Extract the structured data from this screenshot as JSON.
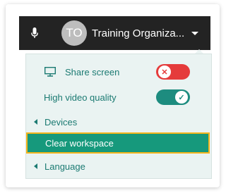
{
  "topbar": {
    "avatar_initials": "TO",
    "org_name": "Training Organiza...",
    "icons": {
      "microphone": "microphone-icon",
      "caret": "caret-down-icon"
    },
    "colors": {
      "background": "#232323",
      "avatar": "#bdbdbd"
    }
  },
  "menu": {
    "share_screen": {
      "label": "Share screen",
      "icon": "monitor-icon",
      "toggle_state": "off",
      "toggle_color": "#e53b3b"
    },
    "high_video_quality": {
      "label": "High video quality",
      "toggle_state": "on",
      "toggle_color": "#1d8c7f"
    },
    "devices": {
      "label": "Devices",
      "icon": "submenu-left-icon"
    },
    "clear_workspace": {
      "label": "Clear workspace",
      "highlighted": true,
      "highlight_color": "#16997c",
      "focus_color": "#f4b51d"
    },
    "language": {
      "label": "Language",
      "icon": "submenu-left-icon"
    },
    "colors": {
      "text": "#1b7a72",
      "background": "#eaf3f2"
    }
  }
}
